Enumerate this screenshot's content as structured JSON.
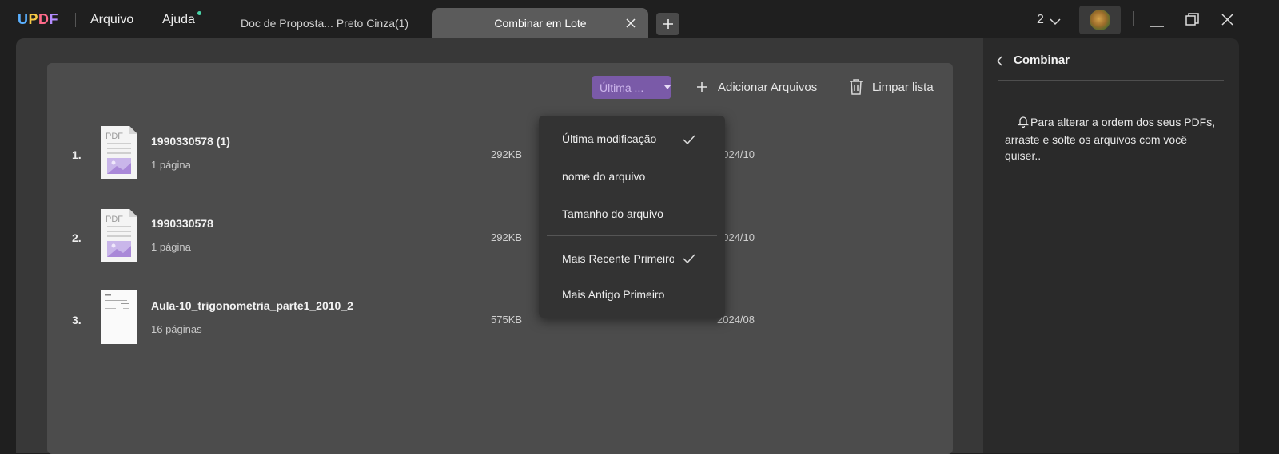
{
  "titlebar": {
    "logo": "UPDF",
    "menu_file": "Arquivo",
    "menu_help": "Ajuda",
    "window_count": "2"
  },
  "tabs": [
    {
      "label": "Doc de Proposta... Preto Cinza(1)",
      "active": false
    },
    {
      "label": "Combinar em Lote",
      "active": true
    }
  ],
  "toolbar": {
    "sort_label": "Última ...",
    "add_files": "Adicionar Arquivos",
    "clear_list": "Limpar lista"
  },
  "files": [
    {
      "index": "1.",
      "name": "1990330578 (1)",
      "pages": "1 página",
      "size": "292KB",
      "date": "2024/10",
      "thumb": "pdf"
    },
    {
      "index": "2.",
      "name": "1990330578",
      "pages": "1 página",
      "size": "292KB",
      "date": "2024/10",
      "thumb": "pdf"
    },
    {
      "index": "3.",
      "name": "Aula-10_trigonometria_parte1_2010_2",
      "pages": "16 páginas",
      "size": "575KB",
      "date": "2024/08",
      "thumb": "document"
    }
  ],
  "sort_menu": {
    "criteria": [
      {
        "label": "Última modificação",
        "checked": true
      },
      {
        "label": "nome do arquivo",
        "checked": false
      },
      {
        "label": "Tamanho do arquivo",
        "checked": false
      }
    ],
    "order": [
      {
        "label": "Mais Recente Primeiro",
        "checked": true
      },
      {
        "label": "Mais Antigo Primeiro",
        "checked": false
      }
    ]
  },
  "side_panel": {
    "title": "Combinar",
    "note": "Para alterar a ordem dos seus PDFs, arraste e solte os arquivos com você quiser.."
  },
  "colors": {
    "accent_purple": "#7a5aa8",
    "notification_dot": "#4ad3a8"
  }
}
